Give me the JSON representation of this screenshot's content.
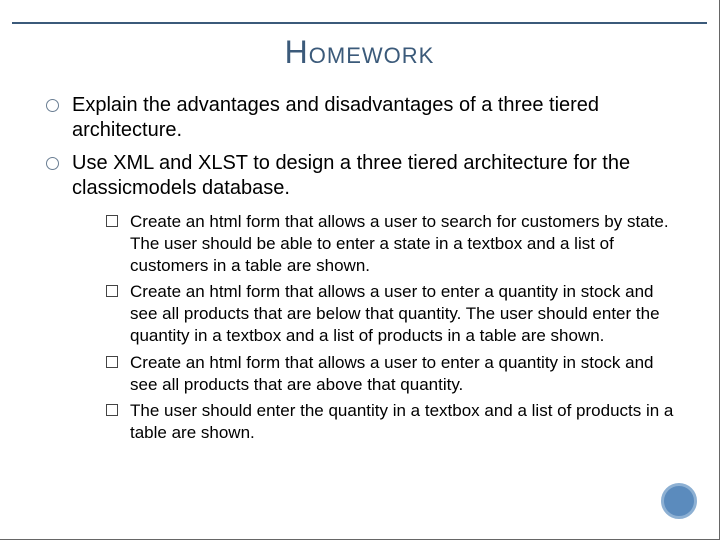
{
  "title": "Homework",
  "bullets": [
    {
      "text": "Explain the advantages and disadvantages of a three tiered architecture."
    },
    {
      "text": "Use XML and XLST to design a three tiered architecture for the classicmodels database."
    }
  ],
  "subbullets": [
    {
      "text": "Create an html form that allows a user to search for  customers by state. The user should be able to enter a state in a textbox and a list of customers in a table are shown."
    },
    {
      "text": "Create an html form that allows a user to enter a quantity in stock and see all products that are below that quantity. The user should enter the quantity in a textbox and a list of products in a table are shown."
    },
    {
      "text": "Create an html form that allows a user to enter a quantity in stock and see all products that are above that quantity."
    },
    {
      "text": "The user should enter the quantity in a textbox and a list of products in a table are shown."
    }
  ]
}
